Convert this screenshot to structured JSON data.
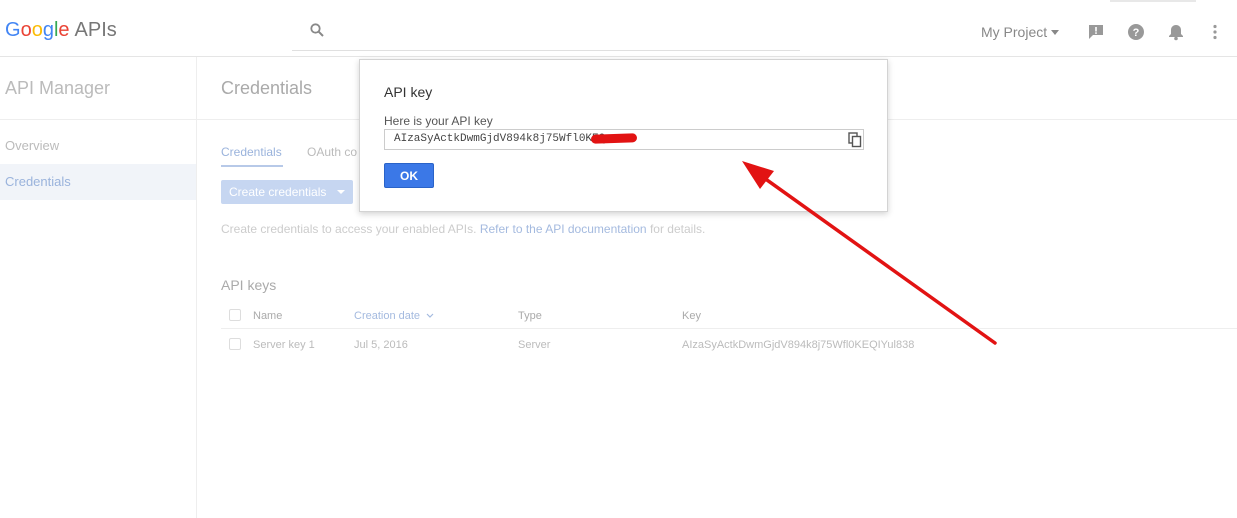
{
  "header": {
    "logo_letters": [
      "G",
      "o",
      "o",
      "g",
      "l",
      "e"
    ],
    "logo_suffix": "APIs",
    "project_label": "My Project",
    "icons": [
      "search-icon",
      "feedback-icon",
      "help-icon",
      "notifications-icon",
      "more-vert-icon"
    ]
  },
  "sidebar": {
    "title": "API Manager",
    "items": [
      {
        "label": "Overview"
      },
      {
        "label": "Credentials"
      }
    ]
  },
  "main": {
    "title": "Credentials",
    "tabs": [
      {
        "label": "Credentials"
      },
      {
        "label": "OAuth co"
      }
    ],
    "create_button": "Create credentials",
    "info_text_before": "Create credentials to access your enabled APIs.",
    "info_link": "Refer to the API documentation",
    "info_text_after": "for details.",
    "section_title": "API keys",
    "columns": [
      "Name",
      "Creation date",
      "Type",
      "Key"
    ],
    "rows": [
      {
        "name": "Server key 1",
        "date": "Jul 5, 2016",
        "type": "Server",
        "key": "AIzaSyActkDwmGjdV894k8j75Wfl0KEQIYul838"
      }
    ]
  },
  "dialog": {
    "title": "API key",
    "label": "Here is your API key",
    "key_visible": "AIzaSyActkDwmGjdV894k8j75Wfl0KEQ",
    "ok_label": "OK"
  },
  "colors": {
    "accent": "#3b78e7",
    "annotation": "#e21313"
  }
}
